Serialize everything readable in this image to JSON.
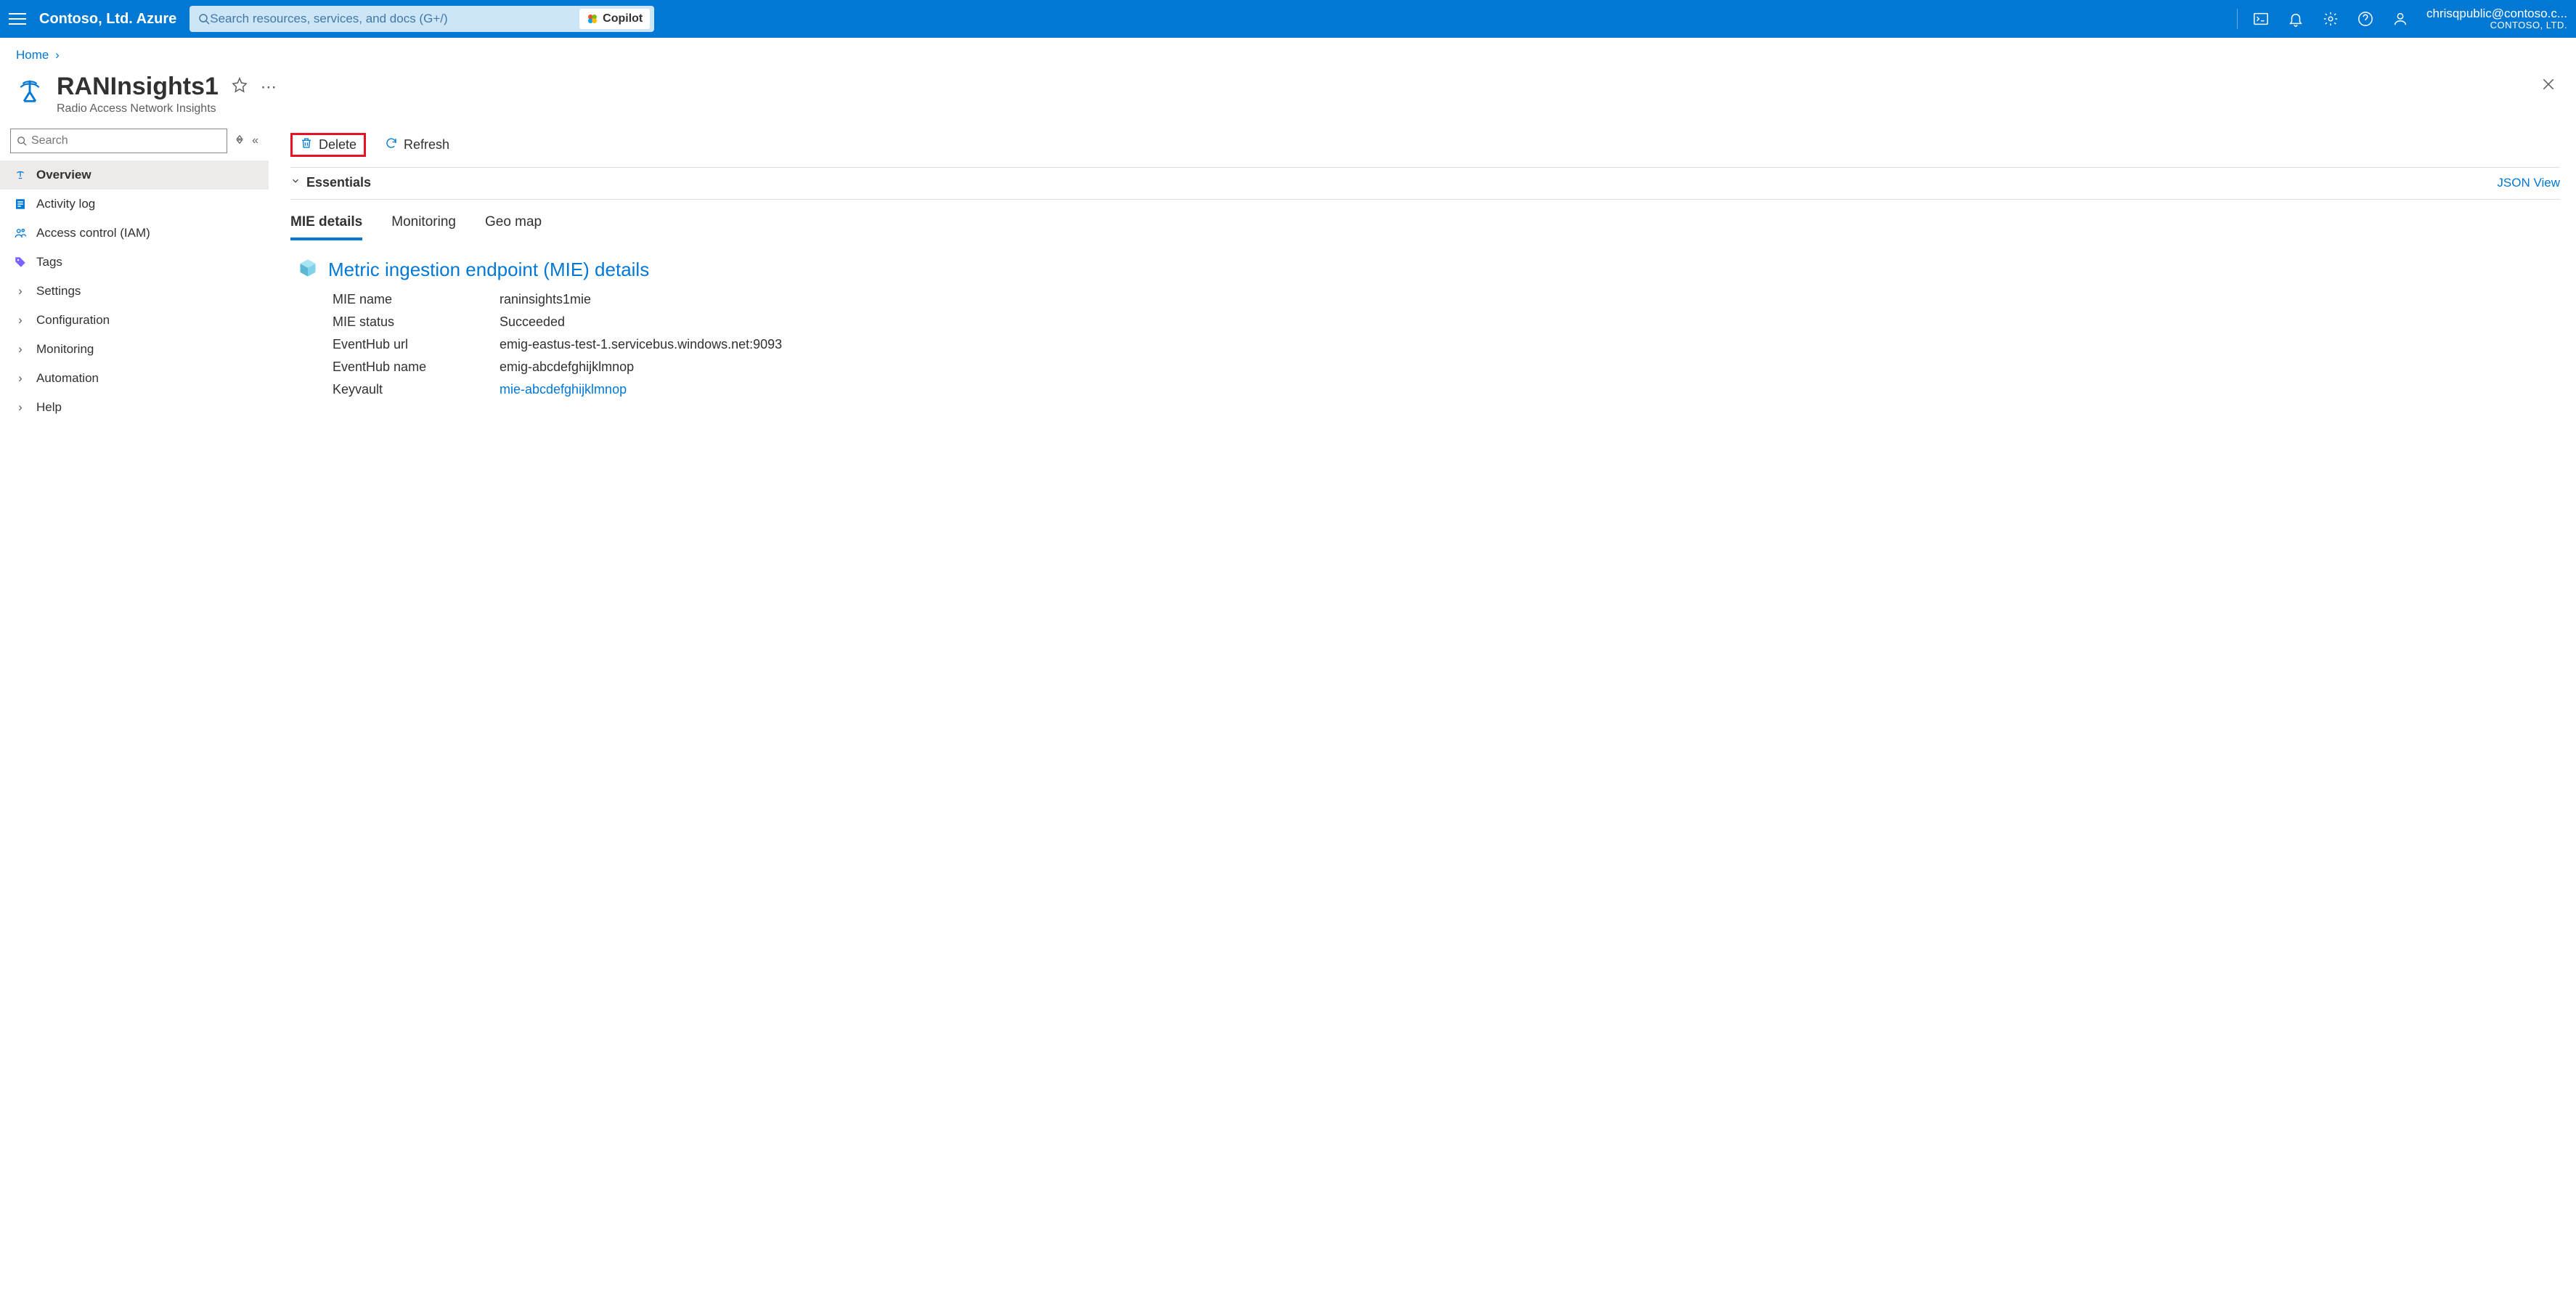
{
  "header": {
    "brand": "Contoso, Ltd. Azure",
    "search_placeholder": "Search resources, services, and docs (G+/)",
    "copilot_label": "Copilot",
    "account_email": "chrisqpublic@contoso.c...",
    "account_tenant": "CONTOSO, LTD."
  },
  "breadcrumb": {
    "home": "Home"
  },
  "resource": {
    "title": "RANInsights1",
    "subtitle": "Radio Access Network Insights"
  },
  "sidebar": {
    "search_placeholder": "Search",
    "items": [
      {
        "label": "Overview"
      },
      {
        "label": "Activity log"
      },
      {
        "label": "Access control (IAM)"
      },
      {
        "label": "Tags"
      },
      {
        "label": "Settings"
      },
      {
        "label": "Configuration"
      },
      {
        "label": "Monitoring"
      },
      {
        "label": "Automation"
      },
      {
        "label": "Help"
      }
    ]
  },
  "toolbar": {
    "delete_label": "Delete",
    "refresh_label": "Refresh"
  },
  "essentials": {
    "label": "Essentials",
    "json_view": "JSON View"
  },
  "tabs": [
    {
      "label": "MIE details"
    },
    {
      "label": "Monitoring"
    },
    {
      "label": "Geo map"
    }
  ],
  "mie": {
    "section_title": "Metric ingestion endpoint (MIE) details",
    "rows": [
      {
        "k": "MIE name",
        "v": "raninsights1mie"
      },
      {
        "k": "MIE status",
        "v": "Succeeded"
      },
      {
        "k": "EventHub url",
        "v": "emig-eastus-test-1.servicebus.windows.net:9093"
      },
      {
        "k": "EventHub name",
        "v": "emig-abcdefghijklmnop"
      },
      {
        "k": "Keyvault",
        "v": "mie-abcdefghijklmnop",
        "link": true
      }
    ]
  }
}
